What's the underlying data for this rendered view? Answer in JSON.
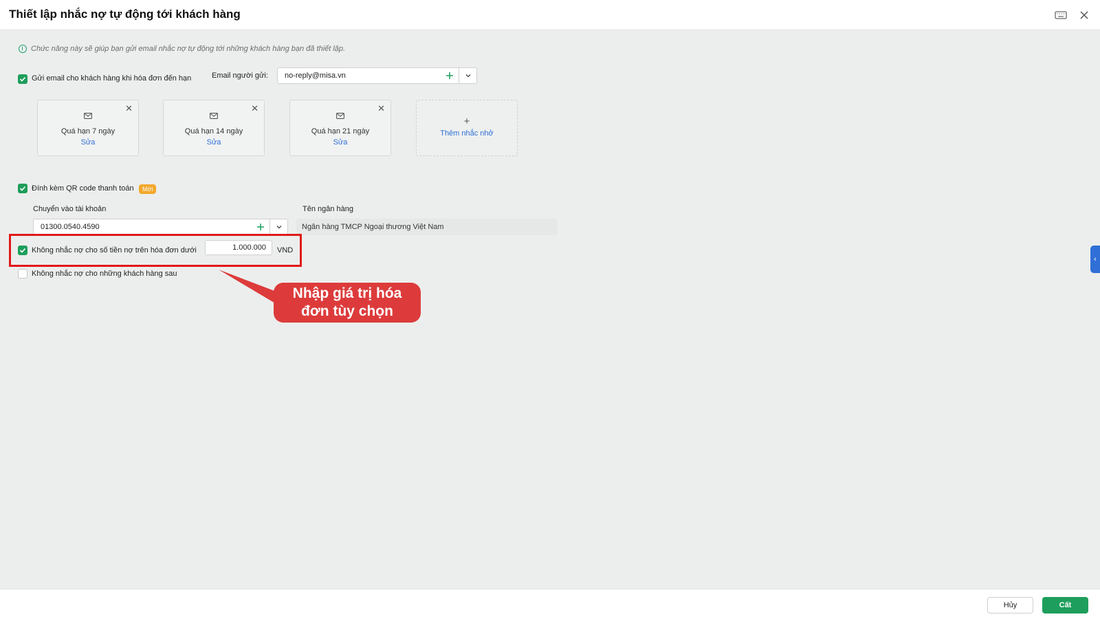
{
  "dialog": {
    "title": "Thiết lập nhắc nợ tự động tới khách hàng"
  },
  "info_text": "Chức năng này sẽ giúp bạn gửi email nhắc nợ tự động tới những khách hàng bạn đã thiết lập.",
  "send_email": {
    "checked": true,
    "label": "Gửi email cho khách hàng khi hóa đơn đến hạn",
    "sender_label": "Email người gửi:",
    "sender_value": "no-reply@misa.vn"
  },
  "reminders": [
    {
      "name": "Quá hạn 7 ngày",
      "edit": "Sửa"
    },
    {
      "name": "Quá hạn 14 ngày",
      "edit": "Sửa"
    },
    {
      "name": "Quá hạn 21 ngày",
      "edit": "Sửa"
    }
  ],
  "add_reminder": {
    "plus": "+",
    "label": "Thêm nhắc nhở"
  },
  "qr": {
    "checked": true,
    "label": "Đính kèm QR code thanh toán",
    "badge": "Mới",
    "account_label": "Chuyển vào tài khoản",
    "account_value": "01300.0540.4590",
    "bank_label": "Tên ngân hàng",
    "bank_value": "Ngân hàng TMCP Ngoại thương Việt Nam"
  },
  "min_amount": {
    "checked": true,
    "label": "Không nhắc nợ cho số tiền nợ trên hóa đơn dưới",
    "value": "1.000.000",
    "currency": "VND"
  },
  "exclude_customers": {
    "checked": false,
    "label": "Không nhắc nợ cho những khách hàng sau"
  },
  "callout": {
    "line1": "Nhập giá trị hóa",
    "line2": "đơn tùy chọn"
  },
  "footer": {
    "cancel_label": "Hủy",
    "save_label": "Cất"
  },
  "colors": {
    "accent_green": "#1e9e5c",
    "link_blue": "#2f6fd6",
    "highlight_red": "#e01919",
    "callout_red": "#dd3b3b",
    "badge_orange": "#f3a82c"
  },
  "icons": [
    "keyboard-icon",
    "close-icon",
    "info-icon",
    "mail-icon",
    "plus-icon",
    "chevron-down-icon",
    "chevron-left-icon",
    "check-icon"
  ]
}
